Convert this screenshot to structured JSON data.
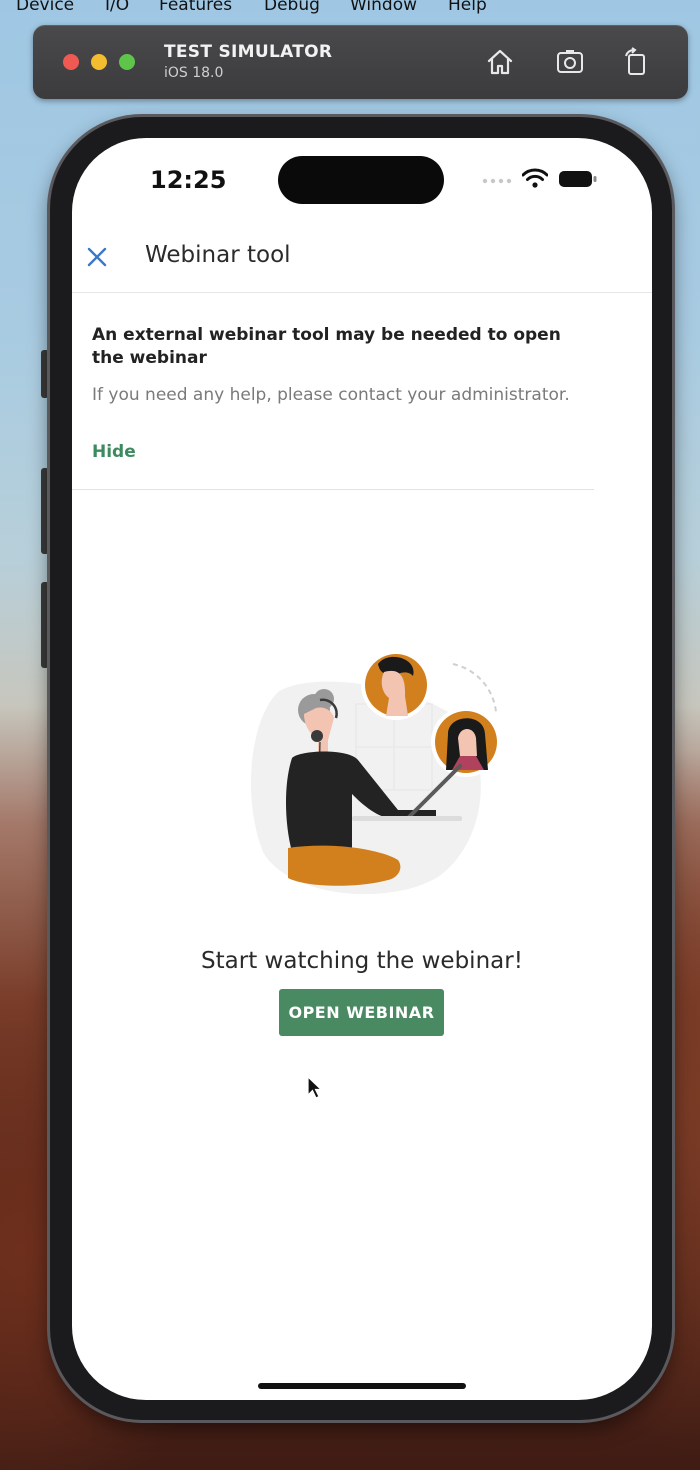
{
  "menubar": {
    "items": [
      "Device",
      "I/O",
      "Features",
      "Debug",
      "Window",
      "Help"
    ]
  },
  "simulator": {
    "title": "TEST SIMULATOR",
    "subtitle": "iOS 18.0",
    "icons": [
      "home-icon",
      "screenshot-icon",
      "rotate-icon"
    ]
  },
  "status_bar": {
    "time": "12:25"
  },
  "nav": {
    "title": "Webinar tool",
    "close_icon": "close-icon"
  },
  "banner": {
    "heading": "An external webinar tool may be needed to open the webinar",
    "text": "If you need any help, please contact your administrator.",
    "hide_label": "Hide"
  },
  "content": {
    "heading": "Start watching the webinar!",
    "button_label": "OPEN WEBINAR"
  },
  "colors": {
    "accent_green": "#4a8a62",
    "link_green": "#3d8a5f",
    "close_blue": "#3a78c9",
    "illustration_orange": "#d2801e"
  }
}
